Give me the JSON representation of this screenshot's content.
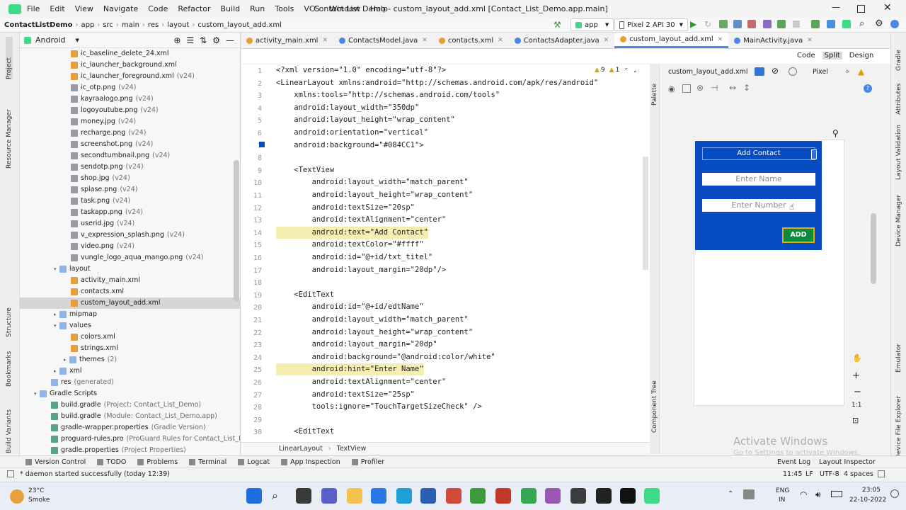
{
  "window": {
    "title": "Contact List Demo - custom_layout_add.xml [Contact_List_Demo.app.main]"
  },
  "menu": [
    "File",
    "Edit",
    "View",
    "Navigate",
    "Code",
    "Refactor",
    "Build",
    "Run",
    "Tools",
    "VCS",
    "Window",
    "Help"
  ],
  "breadcrumb": [
    "ContactListDemo",
    "app",
    "src",
    "main",
    "res",
    "layout",
    "custom_layout_add.xml"
  ],
  "run": {
    "config": "app",
    "device": "Pixel 2 API 30"
  },
  "project": {
    "view": "Android",
    "items": [
      {
        "label": "ic_baseline_delete_24.xml",
        "meta": ""
      },
      {
        "label": "ic_launcher_background.xml",
        "meta": ""
      },
      {
        "label": "ic_launcher_foreground.xml",
        "meta": "(v24)"
      },
      {
        "label": "ic_otp.png",
        "meta": "(v24)"
      },
      {
        "label": "kayraalogo.png",
        "meta": "(v24)"
      },
      {
        "label": "logoyoutube.png",
        "meta": "(v24)"
      },
      {
        "label": "money.jpg",
        "meta": "(v24)"
      },
      {
        "label": "recharge.png",
        "meta": "(v24)"
      },
      {
        "label": "screenshot.png",
        "meta": "(v24)"
      },
      {
        "label": "secondtumbnail.png",
        "meta": "(v24)"
      },
      {
        "label": "sendotp.png",
        "meta": "(v24)"
      },
      {
        "label": "shop.jpg",
        "meta": "(v24)"
      },
      {
        "label": "splase.png",
        "meta": "(v24)"
      },
      {
        "label": "task.png",
        "meta": "(v24)"
      },
      {
        "label": "taskapp.png",
        "meta": "(v24)"
      },
      {
        "label": "userid.jpg",
        "meta": "(v24)"
      },
      {
        "label": "v_expression_splash.png",
        "meta": "(v24)"
      },
      {
        "label": "video.png",
        "meta": "(v24)"
      },
      {
        "label": "vungle_logo_aqua_mango.png",
        "meta": "(v24)"
      },
      {
        "label": "layout",
        "meta": ""
      },
      {
        "label": "activity_main.xml",
        "meta": ""
      },
      {
        "label": "contacts.xml",
        "meta": ""
      },
      {
        "label": "custom_layout_add.xml",
        "meta": ""
      },
      {
        "label": "mipmap",
        "meta": ""
      },
      {
        "label": "values",
        "meta": ""
      },
      {
        "label": "colors.xml",
        "meta": ""
      },
      {
        "label": "strings.xml",
        "meta": ""
      },
      {
        "label": "themes",
        "meta": "(2)"
      },
      {
        "label": "xml",
        "meta": ""
      },
      {
        "label": "res",
        "meta": "(generated)"
      },
      {
        "label": "Gradle Scripts",
        "meta": ""
      },
      {
        "label": "build.gradle",
        "meta": "(Project: Contact_List_Demo)"
      },
      {
        "label": "build.gradle",
        "meta": "(Module: Contact_List_Demo.app)"
      },
      {
        "label": "gradle-wrapper.properties",
        "meta": "(Gradle Version)"
      },
      {
        "label": "proguard-rules.pro",
        "meta": "(ProGuard Rules for Contact_List_Demo.app)"
      },
      {
        "label": "gradle.properties",
        "meta": "(Project Properties)"
      }
    ]
  },
  "tabs": [
    "activity_main.xml",
    "ContactsModel.java",
    "contacts.xml",
    "ContactsAdapter.java",
    "custom_layout_add.xml",
    "MainActivity.java"
  ],
  "editor": {
    "lines": [
      {
        "n": "1",
        "t": "<?xml version=\"1.0\" encoding=\"utf-8\"?>"
      },
      {
        "n": "2",
        "t": "<LinearLayout xmlns:android=\"http://schemas.android.com/apk/res/android\""
      },
      {
        "n": "3",
        "t": "    xmlns:tools=\"http://schemas.android.com/tools\""
      },
      {
        "n": "4",
        "t": "    android:layout_width=\"350dp\""
      },
      {
        "n": "5",
        "t": "    android:layout_height=\"wrap_content\""
      },
      {
        "n": "6",
        "t": "    android:orientation=\"vertical\""
      },
      {
        "n": "7",
        "t": "    android:background=\"#084CC1\">"
      },
      {
        "n": "8",
        "t": ""
      },
      {
        "n": "9",
        "t": "    <TextView"
      },
      {
        "n": "10",
        "t": "        android:layout_width=\"match_parent\""
      },
      {
        "n": "11",
        "t": "        android:layout_height=\"wrap_content\""
      },
      {
        "n": "12",
        "t": "        android:textSize=\"20sp\""
      },
      {
        "n": "13",
        "t": "        android:textAlignment=\"center\""
      },
      {
        "n": "14",
        "t": "        android:text=\"Add Contact\""
      },
      {
        "n": "15",
        "t": "        android:textColor=\"#ffff\""
      },
      {
        "n": "16",
        "t": "        android:id=\"@+id/txt_titel\""
      },
      {
        "n": "17",
        "t": "        android:layout_margin=\"20dp\"/>"
      },
      {
        "n": "18",
        "t": ""
      },
      {
        "n": "19",
        "t": "    <EditText"
      },
      {
        "n": "20",
        "t": "        android:id=\"@+id/edtName\""
      },
      {
        "n": "21",
        "t": "        android:layout_width=\"match_parent\""
      },
      {
        "n": "22",
        "t": "        android:layout_height=\"wrap_content\""
      },
      {
        "n": "23",
        "t": "        android:layout_margin=\"20dp\""
      },
      {
        "n": "24",
        "t": "        android:background=\"@android:color/white\""
      },
      {
        "n": "25",
        "t": "        android:hint=\"Enter Name\""
      },
      {
        "n": "26",
        "t": "        android:textAlignment=\"center\""
      },
      {
        "n": "27",
        "t": "        android:textSize=\"25sp\""
      },
      {
        "n": "28",
        "t": "        tools:ignore=\"TouchTargetSizeCheck\" />"
      },
      {
        "n": "29",
        "t": ""
      },
      {
        "n": "30",
        "t": "    <EditText"
      }
    ],
    "warnings": "9",
    "errors": "1",
    "status_path": [
      "LinearLayout",
      "TextView"
    ]
  },
  "design": {
    "file": "custom_layout_add.xml",
    "device": "Pixel",
    "modes": [
      "Code",
      "Split",
      "Design"
    ],
    "preview": {
      "title": "Add Contact",
      "name_hint": "Enter Name",
      "number_hint": "Enter Number",
      "button": "ADD",
      "bg": "#084CC1"
    },
    "zoom_fit": "1:1",
    "activate_title": "Activate Windows",
    "activate_sub": "Go to Settings to activate Windows."
  },
  "side_labels": {
    "left": [
      "Project",
      "Resource Manager",
      "Structure",
      "Bookmarks",
      "Build Variants"
    ],
    "right": [
      "Gradle",
      "Attributes",
      "Layout Validation",
      "Device Manager",
      "Emulator",
      "Device File Explorer"
    ],
    "palette": "Palette",
    "component_tree": "Component Tree"
  },
  "toolwindows": [
    "Version Control",
    "TODO",
    "Problems",
    "Terminal",
    "Logcat",
    "App Inspection",
    "Profiler"
  ],
  "toolwindows_right": [
    "Event Log",
    "Layout Inspector"
  ],
  "status": {
    "message": "* daemon started successfully (today 12:39)",
    "pos": "11:45",
    "ending": "LF",
    "encoding": "UTF-8",
    "indent": "4 spaces"
  },
  "taskbar": {
    "temp": "23°C",
    "weather": "Smoke",
    "lang1": "ENG",
    "lang2": "IN",
    "time": "23:05",
    "date": "22-10-2022"
  }
}
